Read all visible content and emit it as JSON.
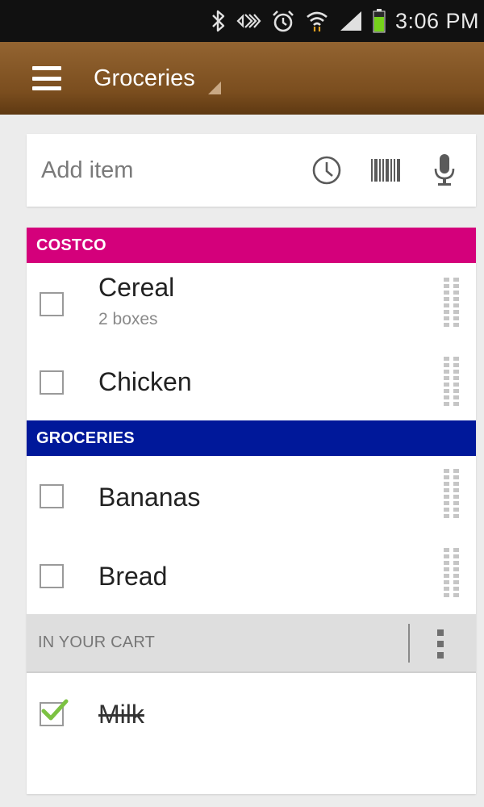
{
  "status_bar": {
    "time": "3:06 PM",
    "icons": [
      "bluetooth-icon",
      "nfc-icon",
      "alarm-icon",
      "wifi-icon",
      "signal-icon",
      "battery-icon"
    ],
    "battery_color": "#76d21b"
  },
  "action_bar": {
    "title": "Groceries",
    "background": "#7a4d1e"
  },
  "add_item": {
    "placeholder": "Add item",
    "icons": [
      "history-icon",
      "barcode-icon",
      "microphone-icon"
    ]
  },
  "sections": [
    {
      "name": "COSTCO",
      "color": "#d4007b",
      "items": [
        {
          "name": "Cereal",
          "note": "2 boxes",
          "checked": false
        },
        {
          "name": "Chicken",
          "note": "",
          "checked": false
        }
      ]
    },
    {
      "name": "GROCERIES",
      "color": "#00189a",
      "items": [
        {
          "name": "Bananas",
          "note": "",
          "checked": false
        },
        {
          "name": "Bread",
          "note": "",
          "checked": false
        }
      ]
    }
  ],
  "cart": {
    "label": "IN YOUR CART",
    "items": [
      {
        "name": "Milk",
        "checked": true
      }
    ],
    "check_color": "#7cc242"
  }
}
